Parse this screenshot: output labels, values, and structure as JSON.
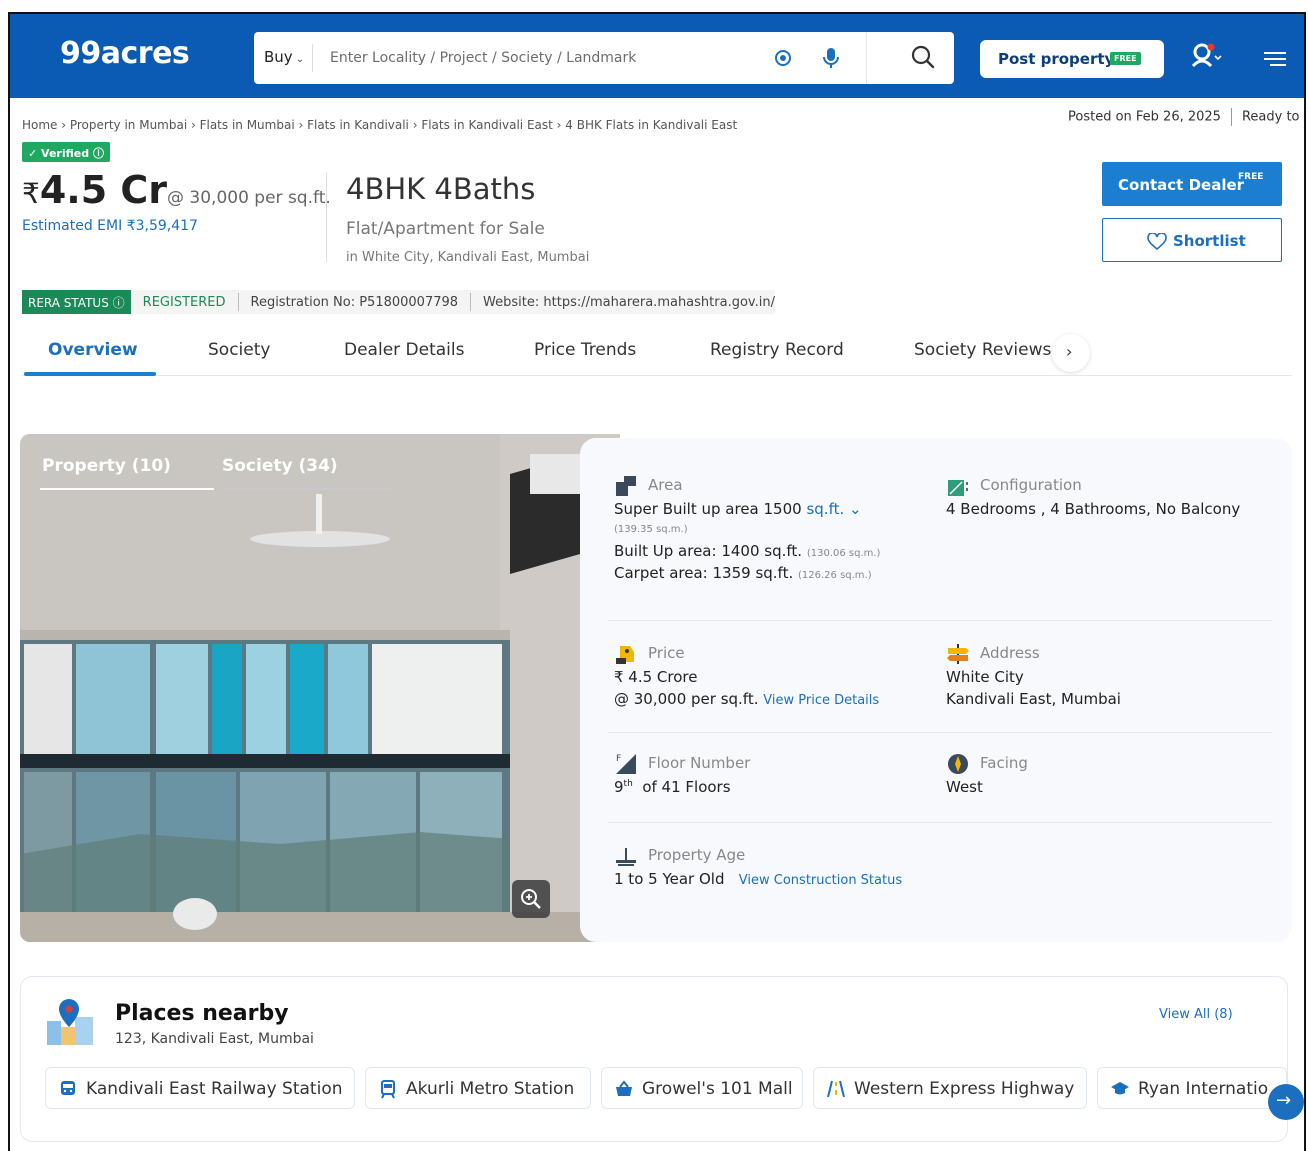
{
  "header": {
    "logo": "99acres",
    "search": {
      "mode": "Buy",
      "placeholder": "Enter Locality / Project / Society / Landmark"
    },
    "post_property": "Post property",
    "post_badge": "FREE"
  },
  "breadcrumb": "Home › Property in Mumbai › Flats in Mumbai › Flats in Kandivali › Flats in Kandivali East › 4 BHK Flats in Kandivali East",
  "posted": {
    "date": "Posted on Feb 26, 2025",
    "status": "Ready to move"
  },
  "listing": {
    "verified": "Verified",
    "currency": "₹",
    "price": "4.5 Cr",
    "per_sqft": "@ 30,000 per sq.ft.",
    "emi": "Estimated EMI ₹3,59,417",
    "title": "4BHK 4Baths",
    "subtitle": "Flat/Apartment for Sale",
    "location": "in White City, Kandivali East, Mumbai",
    "contact": "Contact Dealer",
    "contact_badge": "FREE",
    "shortlist": "Shortlist"
  },
  "rera": {
    "status_label": "RERA STATUS",
    "status": "REGISTERED",
    "registration": "Registration No: P51800007798",
    "website": "Website: https://maharera.mahashtra.gov.in/"
  },
  "tabs": [
    "Overview",
    "Society",
    "Dealer Details",
    "Price Trends",
    "Registry Record",
    "Society Reviews"
  ],
  "gallery": {
    "tab1": "Property (10)",
    "tab2": "Society (34)"
  },
  "details": {
    "area": {
      "label": "Area",
      "super": "Super Built up area 1500",
      "unit": "sq.ft.",
      "super_sqm": "(139.35 sq.m.)",
      "built": "Built Up area: 1400 sq.ft.",
      "built_sqm": "(130.06 sq.m.)",
      "carpet": "Carpet area: 1359 sq.ft.",
      "carpet_sqm": "(126.26 sq.m.)"
    },
    "configuration": {
      "label": "Configuration",
      "value": "4 Bedrooms , 4 Bathrooms, No Balcony"
    },
    "price": {
      "label": "Price",
      "value": "₹ 4.5 Crore",
      "per_sqft": "@ 30,000 per sq.ft.",
      "link": "View Price Details"
    },
    "address": {
      "label": "Address",
      "line1": "White City",
      "line2": "Kandivali East, Mumbai"
    },
    "floor": {
      "label": "Floor Number",
      "floor": "9",
      "sup": "th",
      "total": "of 41 Floors"
    },
    "facing": {
      "label": "Facing",
      "value": "West"
    },
    "age": {
      "label": "Property Age",
      "value": "1 to 5 Year Old",
      "link": "View Construction Status"
    }
  },
  "places": {
    "title": "Places nearby",
    "address": "123, Kandivali East, Mumbai",
    "view_all": "View All (8)",
    "items": [
      "Kandivali East Railway Station",
      "Akurli Metro Station",
      "Growel's 101 Mall",
      "Western Express Highway",
      "Ryan Internatio"
    ]
  },
  "colors": {
    "brand_blue": "#0b5bb5",
    "accent_blue": "#1b7ed1",
    "green": "#1b8a58"
  }
}
